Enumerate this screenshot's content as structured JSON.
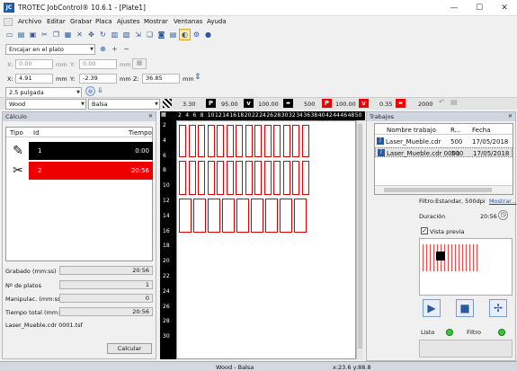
{
  "window": {
    "title": "TROTEC JobControl® 10.6.1 - [Plate1]",
    "minimize": "—",
    "maximize": "☐",
    "close": "✕",
    "app_icon": "JC"
  },
  "menu": [
    "Archivo",
    "Editar",
    "Grabar",
    "Placa",
    "Ajustes",
    "Mostrar",
    "Ventanas",
    "Ayuda"
  ],
  "toolbar2": {
    "fit_combo": "Encajar en el plato"
  },
  "position": {
    "x_label": "X:",
    "x_value": "0.00",
    "x_unit": "mm",
    "y_label": "Y:",
    "y_value": "0.00",
    "y_unit": "mm"
  },
  "position2": {
    "x_label": "X:",
    "x_value": "4.91",
    "x_unit": "mm",
    "y_label": "Y:",
    "y_value": "-2.39",
    "y_unit": "mm",
    "z_label": "Z:",
    "z_value": "36.85",
    "z_unit": "mm"
  },
  "lens": {
    "value": "2.5 pulgada"
  },
  "material": {
    "group": "Wood",
    "name": "Balsa",
    "power_label": "P",
    "speed_label": "v",
    "ppi_label": "P",
    "thickness": "3.30",
    "power1": "95.00",
    "speed1": "100.00",
    "ppi1": "500",
    "power2": "100.00",
    "speed2": "0.35",
    "ppi2": "2000"
  },
  "calc_panel": {
    "title": "Cálculo",
    "col_type": "Tipo",
    "col_id": "Id",
    "col_time": "Tiempo",
    "rows": [
      {
        "id": "1",
        "time": "0:00"
      },
      {
        "id": "2",
        "time": "20:56"
      }
    ],
    "engraving_label": "Grabado (mm:ss)",
    "engraving_value": "20:56",
    "plates_label": "Nº de platos",
    "plates_value": "1",
    "handling_label": "Manipulac. (mm:ss)",
    "handling_value": "0",
    "total_label": "Tiempo total (mm:ss)",
    "total_value": "20:56",
    "file": "Laser_Mueble.cdr 0001.tsf",
    "calc_button": "Calcular"
  },
  "ruler_top": [
    "2",
    "4",
    "6",
    "8",
    "10",
    "12",
    "14",
    "16",
    "18",
    "20",
    "22",
    "24",
    "26",
    "28",
    "30",
    "32",
    "34",
    "36",
    "38",
    "40",
    "42",
    "44",
    "46",
    "48",
    "50"
  ],
  "ruler_left": [
    "2",
    "4",
    "6",
    "8",
    "10",
    "12",
    "14",
    "16",
    "18",
    "20",
    "22",
    "24",
    "26",
    "28",
    "30"
  ],
  "jobs_panel": {
    "title": "Trabajos",
    "col_name": "Nombre trabajo",
    "col_r": "R...",
    "col_date": "Fecha",
    "rows": [
      {
        "name": "Laser_Mueble.cdr",
        "r": "500",
        "date": "17/05/2018"
      },
      {
        "name": "Laser_Mueble.cdr 0001",
        "r": "500",
        "date": "17/05/2018"
      }
    ],
    "filter": "Filtro:Estandar, 500dpi",
    "show_link": "Mostrar...",
    "duration_label": "Duración",
    "duration_value": "20:56",
    "preview_label": "Vista previa",
    "ready_label": "Listo",
    "filter_label": "Filtro"
  },
  "statusbar": {
    "material": "Wood - Balsa",
    "coords": "x:23.6  y:88.8"
  }
}
